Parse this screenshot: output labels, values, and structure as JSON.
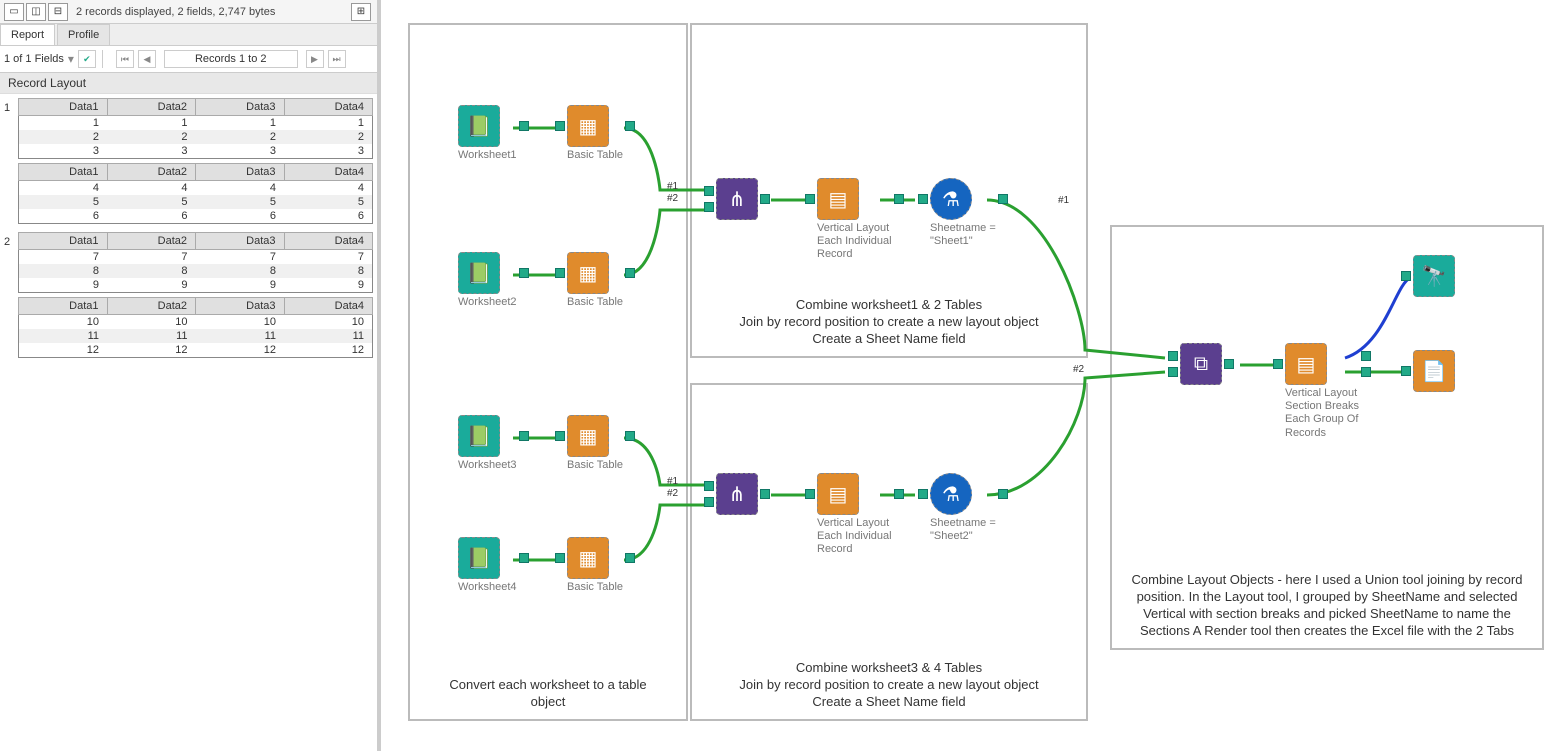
{
  "toolbar": {
    "status": "2 records displayed, 2 fields, 2,747 bytes"
  },
  "tabs": {
    "report": "Report",
    "profile": "Profile"
  },
  "nav": {
    "fields": "1 of 1 Fields",
    "records": "Records 1 to 2"
  },
  "record_layout_header": "Record Layout",
  "headers": [
    "Data1",
    "Data2",
    "Data3",
    "Data4"
  ],
  "records": [
    {
      "num": "1",
      "tables": [
        [
          [
            "1",
            "1",
            "1",
            "1"
          ],
          [
            "2",
            "2",
            "2",
            "2"
          ],
          [
            "3",
            "3",
            "3",
            "3"
          ]
        ],
        [
          [
            "4",
            "4",
            "4",
            "4"
          ],
          [
            "5",
            "5",
            "5",
            "5"
          ],
          [
            "6",
            "6",
            "6",
            "6"
          ]
        ]
      ]
    },
    {
      "num": "2",
      "tables": [
        [
          [
            "7",
            "7",
            "7",
            "7"
          ],
          [
            "8",
            "8",
            "8",
            "8"
          ],
          [
            "9",
            "9",
            "9",
            "9"
          ]
        ],
        [
          [
            "10",
            "10",
            "10",
            "10"
          ],
          [
            "11",
            "11",
            "11",
            "11"
          ],
          [
            "12",
            "12",
            "12",
            "12"
          ]
        ]
      ]
    }
  ],
  "containers": {
    "c1": "Convert each worksheet to a table\nobject",
    "c2": "Combine worksheet1 & 2 Tables\nJoin by record position to create a new layout object\nCreate a Sheet Name field",
    "c3": "Combine worksheet3 & 4 Tables\nJoin by record position to create a new layout object\nCreate a Sheet Name field",
    "c4": "Combine Layout Objects - here I used a Union tool joining by record position.\nIn the Layout tool, I grouped by SheetName and selected Vertical with section breaks and picked SheetName to name the Sections\n\nA Render tool then creates the Excel file with the 2 Tabs"
  },
  "tools": {
    "ws1": "Worksheet1",
    "ws2": "Worksheet2",
    "ws3": "Worksheet3",
    "ws4": "Worksheet4",
    "bt1": "Basic Table",
    "bt2": "Basic Table",
    "bt3": "Basic Table",
    "bt4": "Basic Table",
    "join1": "",
    "join2": "",
    "vl1": "Vertical Layout\nEach Individual\nRecord",
    "vl2": "Vertical Layout\nEach Individual\nRecord",
    "f1": "Sheetname =\n\"Sheet1\"",
    "f2": "Sheetname =\n\"Sheet2\"",
    "union": "",
    "vl3": "Vertical Layout\nSection Breaks\nEach Group Of\nRecords",
    "browse": "",
    "render": ""
  },
  "anchors": {
    "in1": "#1",
    "in2": "#2",
    "out1": "#1",
    "out2": "#2"
  },
  "colors": {
    "teal": "#1aab9b",
    "orange": "#e08b2c",
    "purple": "#5b3f8f",
    "blue": "#1565c0",
    "blueDark": "#0d47a1",
    "wire": "#2aa030",
    "wireBlue": "#1f3fd1"
  }
}
